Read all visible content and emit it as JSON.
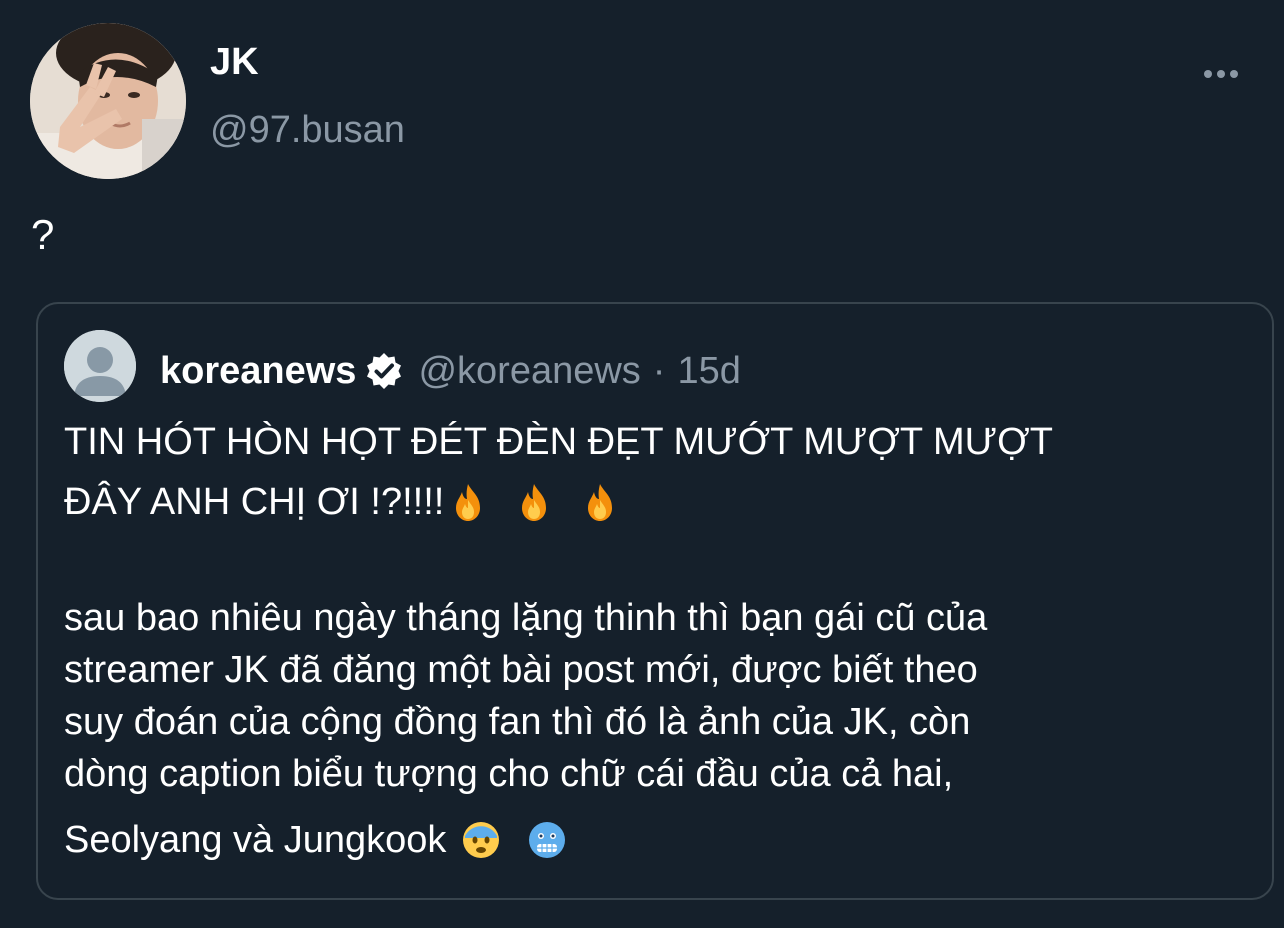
{
  "tweet": {
    "author": {
      "name": "JK",
      "handle": "@97.busan"
    },
    "text": "?",
    "more_icon": "more-horizontal-icon"
  },
  "quoted_tweet": {
    "author": {
      "name": "koreanews",
      "handle": "@koreanews",
      "verified": true
    },
    "separator": "·",
    "time": "15d",
    "line1": "TIN HÓT HÒN HỌT ĐÉT ĐÈN ĐẸT MƯỚT MƯỢT MƯỢT",
    "line2": "ĐÂY ANH CHỊ ƠI !?!!!!",
    "line2_emojis": [
      "fire-emoji",
      "fire-emoji",
      "fire-emoji"
    ],
    "paragraph": [
      "sau bao nhiêu ngày tháng lặng thinh thì bạn gái cũ của",
      "streamer JK đã đăng một bài post mới, được biết theo",
      "suy đoán của cộng đồng fan thì đó là ảnh của JK, còn",
      "dòng caption biểu tượng cho chữ cái đầu của cả hai,"
    ],
    "last_line": "Seolyang và Jungkook",
    "last_line_emojis": [
      "fearful-face-emoji",
      "cold-face-emoji"
    ]
  },
  "colors": {
    "background": "#15202b",
    "text": "#ffffff",
    "muted": "#8b98a5",
    "border": "#38444d"
  }
}
